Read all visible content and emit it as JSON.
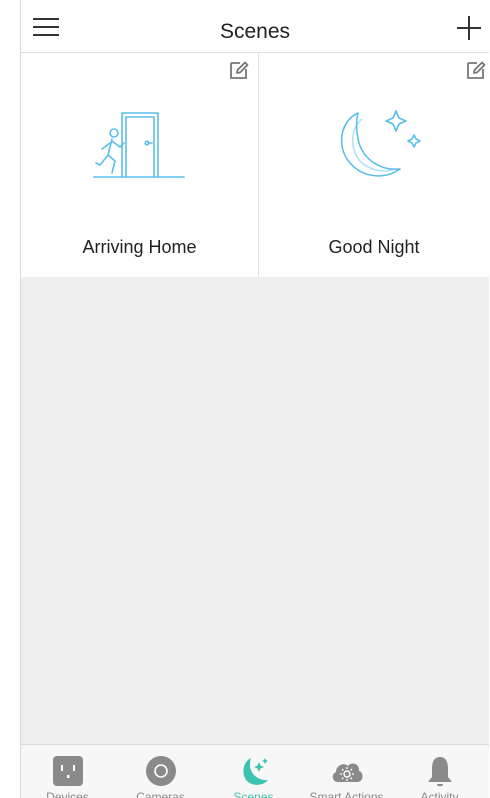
{
  "header": {
    "title": "Scenes"
  },
  "scenes": [
    {
      "label": "Arriving Home",
      "icon": "arriving-home-icon"
    },
    {
      "label": "Good Night",
      "icon": "moon-stars-icon"
    }
  ],
  "tabs": [
    {
      "label": "Devices",
      "icon": "outlet-icon"
    },
    {
      "label": "Cameras",
      "icon": "camera-icon"
    },
    {
      "label": "Scenes",
      "icon": "scenes-icon",
      "active": true
    },
    {
      "label": "Smart Actions",
      "icon": "cloud-sun-icon"
    },
    {
      "label": "Activity",
      "icon": "bell-icon"
    }
  ],
  "colors": {
    "accent": "#3fc3b1",
    "icon_line": "#5bbfe8",
    "muted": "#8a8a8a"
  }
}
